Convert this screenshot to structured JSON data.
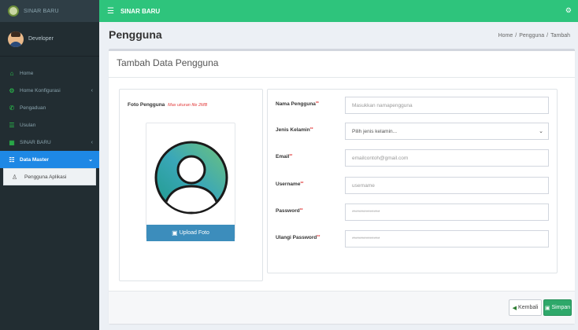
{
  "sidebar": {
    "brand": "SINAR BARU",
    "user_name": "Developer",
    "items": [
      {
        "label": "Home",
        "icon": "home-icon",
        "glyph": "⌂",
        "chevron": ""
      },
      {
        "label": "Home Konfigurasi",
        "icon": "cogs-icon",
        "glyph": "⚙",
        "chevron": "‹"
      },
      {
        "label": "Pengaduan",
        "icon": "phone-icon",
        "glyph": "✆",
        "chevron": ""
      },
      {
        "label": "Usulan",
        "icon": "list-icon",
        "glyph": "☰",
        "chevron": ""
      },
      {
        "label": "SINAR BARU",
        "icon": "building-icon",
        "glyph": "▦",
        "chevron": "‹"
      },
      {
        "label": "Data Master",
        "icon": "database-icon",
        "glyph": "☷",
        "chevron": "⌄"
      }
    ],
    "submenu_label": "Pengguna Aplikasi"
  },
  "topbar": {
    "title": "SINAR BARU"
  },
  "content": {
    "page_title": "Pengguna",
    "breadcrumb": [
      "Home",
      "Pengguna",
      "Tambah"
    ]
  },
  "card": {
    "title": "Tambah Data Pengguna",
    "photo_label": "Foto Pengguna",
    "photo_hint": "Max ukuran file 2MB",
    "upload_button": "Upload Foto",
    "fields": [
      {
        "label": "Nama Pengguna",
        "required": "**",
        "placeholder": "Masukkan namapengguna",
        "type": "text"
      },
      {
        "label": "Jenis Kelamin",
        "required": "**",
        "placeholder": "Pilih jenis kelamin...",
        "type": "select"
      },
      {
        "label": "Email",
        "required": "**",
        "placeholder": "emailcontoh@gmail.com",
        "type": "text"
      },
      {
        "label": "Username",
        "required": "**",
        "placeholder": "username",
        "type": "text"
      },
      {
        "label": "Password",
        "required": "**",
        "placeholder": "**************",
        "type": "password"
      },
      {
        "label": "Ulangi Password",
        "required": "**",
        "placeholder": "**************",
        "type": "password"
      }
    ],
    "back_button": "Kembali",
    "save_button": "Simpan"
  },
  "colors": {
    "topbar": "#2ec47c",
    "sidebar": "#222d32",
    "active_menu": "#1e88e5",
    "upload_button": "#3c8dbc",
    "save_button": "#2ea86a",
    "required_mark": "#e23b3b"
  }
}
